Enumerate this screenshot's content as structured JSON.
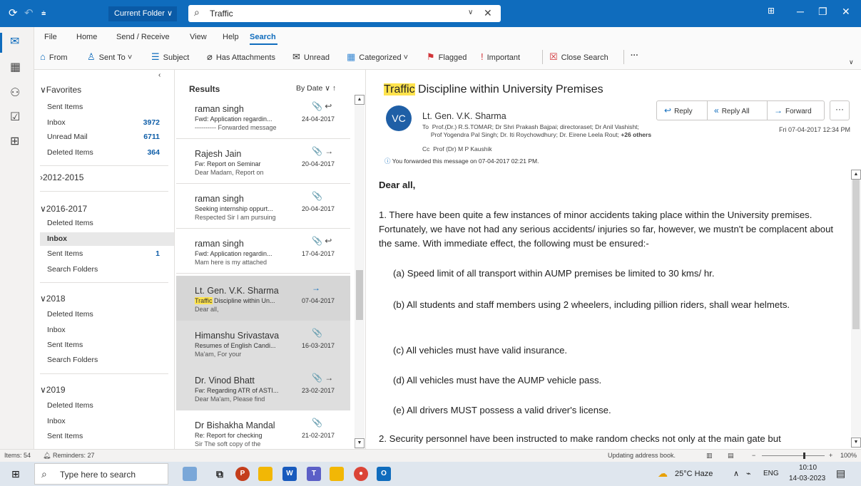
{
  "title_bar": {
    "folder_scope": "Current Folder ∨",
    "search_query": "Traffic"
  },
  "menu_tabs": [
    "File",
    "Home",
    "Send / Receive",
    "View",
    "Help",
    "Search"
  ],
  "ribbon": {
    "from": "From",
    "sent_to": "Sent To ˅",
    "subject": "Subject",
    "has_attachments": "Has Attachments",
    "unread": "Unread",
    "categorized": "Categorized ˅",
    "flagged": "Flagged",
    "important": "Important",
    "close_search": "Close Search",
    "more": "···"
  },
  "folders": {
    "favorites": {
      "label": "Favorites",
      "items": [
        {
          "label": "Sent Items",
          "count": ""
        },
        {
          "label": "Inbox",
          "count": "3972"
        },
        {
          "label": "Unread Mail",
          "count": "6711"
        },
        {
          "label": "Deleted Items",
          "count": "364"
        }
      ]
    },
    "group_2012": "2012-2015",
    "group_2016": {
      "label": "2016-2017",
      "items": [
        {
          "label": "Deleted Items",
          "count": ""
        },
        {
          "label": "Inbox",
          "count": ""
        },
        {
          "label": "Sent Items",
          "count": "1"
        },
        {
          "label": "Search Folders",
          "count": ""
        }
      ]
    },
    "group_2018": {
      "label": "2018",
      "items": [
        {
          "label": "Deleted Items"
        },
        {
          "label": "Inbox"
        },
        {
          "label": "Sent Items"
        },
        {
          "label": "Search Folders"
        }
      ]
    },
    "group_2019": {
      "label": "2019",
      "items": [
        {
          "label": "Deleted Items"
        },
        {
          "label": "Inbox"
        },
        {
          "label": "Sent Items"
        }
      ]
    }
  },
  "message_list": {
    "header": "Results",
    "sort": "By Date ∨  ↑",
    "messages": [
      {
        "sender": "raman singh",
        "subject": "Fwd: Application regardin...",
        "preview": "---------- Forwarded message",
        "date": "24-04-2017",
        "icons": "📎 ↩"
      },
      {
        "sender": "Rajesh Jain",
        "subject": "Fw: Report on Seminar",
        "preview": "Dear Madam,  Report on",
        "date": "20-04-2017",
        "icons": "📎 →"
      },
      {
        "sender": "raman singh",
        "subject": "Seeking internship oppurt...",
        "preview": "Respected Sir  I am  pursuing",
        "date": "20-04-2017",
        "icons": "📎"
      },
      {
        "sender": "raman singh",
        "subject": "Fwd: Application regardin...",
        "preview": "Mam here is my attached",
        "date": "17-04-2017",
        "icons": "📎 ↩"
      },
      {
        "sender": "Lt. Gen. V.K. Sharma",
        "subject_hl": "Traffic",
        "subject": " Discipline within Un...",
        "preview": "Dear all,",
        "date": "07-04-2017",
        "icons": "→"
      },
      {
        "sender": "Himanshu Srivastava",
        "subject": "Resumes of  English Candi...",
        "preview": "Ma'am,  For your",
        "date": "16-03-2017",
        "icons": "📎"
      },
      {
        "sender": "Dr. Vinod Bhatt",
        "subject": "Fw: Regarding ATR of ASTI...",
        "preview": "Dear Ma'am,   Please find",
        "date": "23-02-2017",
        "icons": "📎 →"
      },
      {
        "sender": "Dr Bishakha Mandal",
        "subject": "Re: Report for checking",
        "preview": "Sir  The soft copy of the",
        "date": "21-02-2017",
        "icons": "📎"
      }
    ]
  },
  "reading_pane": {
    "subject_hl": "Traffic",
    "subject": " Discipline within University Premises",
    "avatar": "VC",
    "sender": "Lt. Gen. V.K. Sharma",
    "to_label": "To",
    "to": "Prof.(Dr.) R.S.TOMAR; Dr Shri Prakash Bajpai; directoraset; Dr Anil Vashisht;",
    "to_cont": "Prof Yogendra Pal Singh; Dr. Iti Roychowdhury; Dr. Eirene Leela Rout;",
    "to_others": "+26 others",
    "cc_label": "Cc",
    "cc": "Prof (Dr) M P Kaushik",
    "forward_note": "You forwarded this message on 07-04-2017 02:21 PM.",
    "date": "Fri 07-04-2017 12:34 PM",
    "actions": {
      "reply": "Reply",
      "reply_all": "Reply All",
      "forward": "Forward",
      "more": "···"
    },
    "body": {
      "greeting": "Dear all,",
      "p1": "1.  There have been quite a few instances of minor accidents taking place within the University premises. Fortunately, we have not had any serious accidents/ injuries so far, however, we mustn't be complacent about the same. With immediate effect, the following must be ensured:-",
      "a": "(a)  Speed limit of all transport within AUMP premises be limited to 30 kms/ hr.",
      "b": "(b)  All students and staff members using 2 wheelers, including pillion riders, shall wear helmets.",
      "c": "(c)  All vehicles must have valid insurance.",
      "d": "(d)  All vehicles must have the AUMP vehicle pass.",
      "e": "(e)  All drivers MUST possess a valid driver's license.",
      "p2": "2.  Security personnel have been instructed to make random checks not only at the main gate but"
    }
  },
  "status_bar": {
    "items": "Items: 54",
    "reminders": "Reminders: 27",
    "updating": "Updating address book.",
    "zoom": "100%"
  },
  "taskbar": {
    "search_placeholder": "Type here to search",
    "weather": "25°C  Haze",
    "lang": "ENG",
    "time": "10:10",
    "date": "14-03-2023"
  }
}
